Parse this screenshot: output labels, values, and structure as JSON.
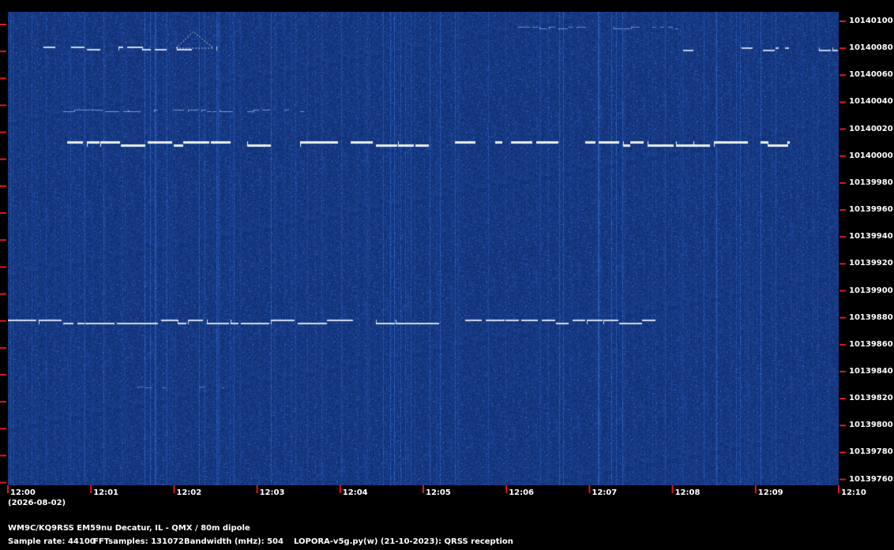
{
  "waterfall": {
    "background": "#0a2a66",
    "trace_color": "#ffffff",
    "tick_color": "#e01818"
  },
  "frequency_axis": {
    "labels": [
      "10140100",
      "10140080",
      "10140060",
      "10140040",
      "10140020",
      "10140000",
      "10139980",
      "10139960",
      "10139940",
      "10139920",
      "10139900",
      "10139880",
      "10139860",
      "10139840",
      "10139820",
      "10139800",
      "10139780",
      "10139760"
    ]
  },
  "time_axis": {
    "labels": [
      "12:00",
      "12:01",
      "12:02",
      "12:03",
      "12:04",
      "12:05",
      "12:06",
      "12:07",
      "12:08",
      "12:09",
      "12:10"
    ],
    "date": "(2026-08-02)"
  },
  "footer": {
    "station": "WM9C/KQ9RSS EM59nu Decatur, IL - QMX / 80m dipole",
    "sample_rate": "Sample rate: 44100",
    "fft_samples": "FFTsamples: 131072",
    "bandwidth": "Bandwidth (mHz): 504",
    "software": "LOPORA-v5g.py(w) (21-10-2023): QRSS reception"
  }
}
